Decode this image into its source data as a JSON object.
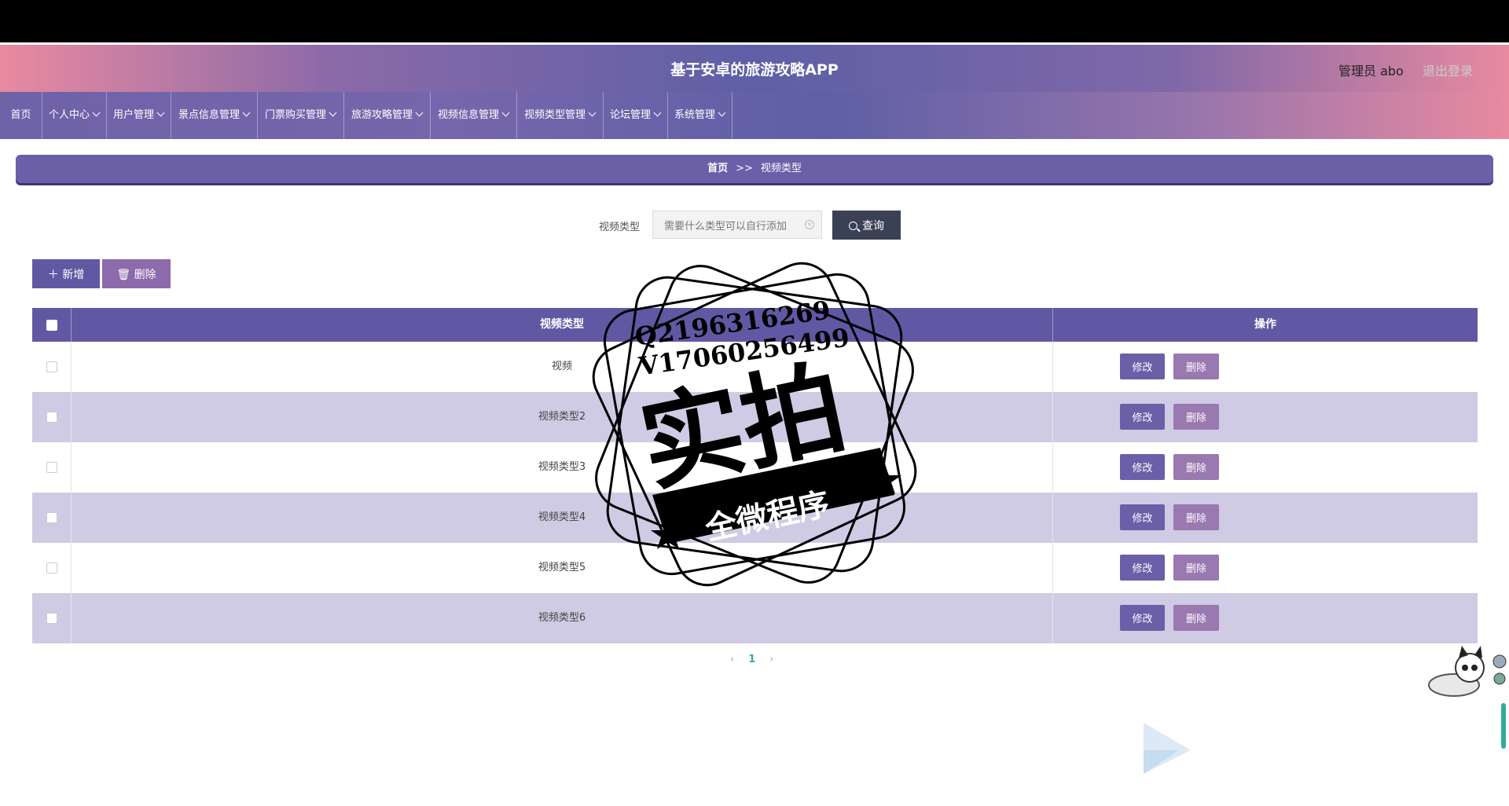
{
  "header": {
    "title": "基于安卓的旅游攻略APP",
    "user": "管理员 abo",
    "logout": "退出登录"
  },
  "nav": [
    "首页",
    "个人中心",
    "用户管理",
    "景点信息管理",
    "门票购买管理",
    "旅游攻略管理",
    "视频信息管理",
    "视频类型管理",
    "论坛管理",
    "系统管理"
  ],
  "breadcrumb": {
    "home": "首页",
    "sep": ">>",
    "current": "视频类型"
  },
  "search": {
    "label": "视频类型",
    "value": "需要什么类型可以自行添加",
    "button": "查询"
  },
  "toolbar": {
    "add": "新增",
    "delete": "删除"
  },
  "table": {
    "headers": [
      "视频类型",
      "操作"
    ],
    "rows": [
      "视频",
      "视频类型2",
      "视频类型3",
      "视频类型4",
      "视频类型5",
      "视频类型6"
    ],
    "edit": "修改",
    "delete": "删除"
  },
  "pagination": {
    "prev": "‹",
    "page": "1",
    "next": "›"
  },
  "watermark": {
    "line1": "Q2196316269",
    "line2": "V17060256499",
    "main": "实拍",
    "banner": "全微程序"
  }
}
